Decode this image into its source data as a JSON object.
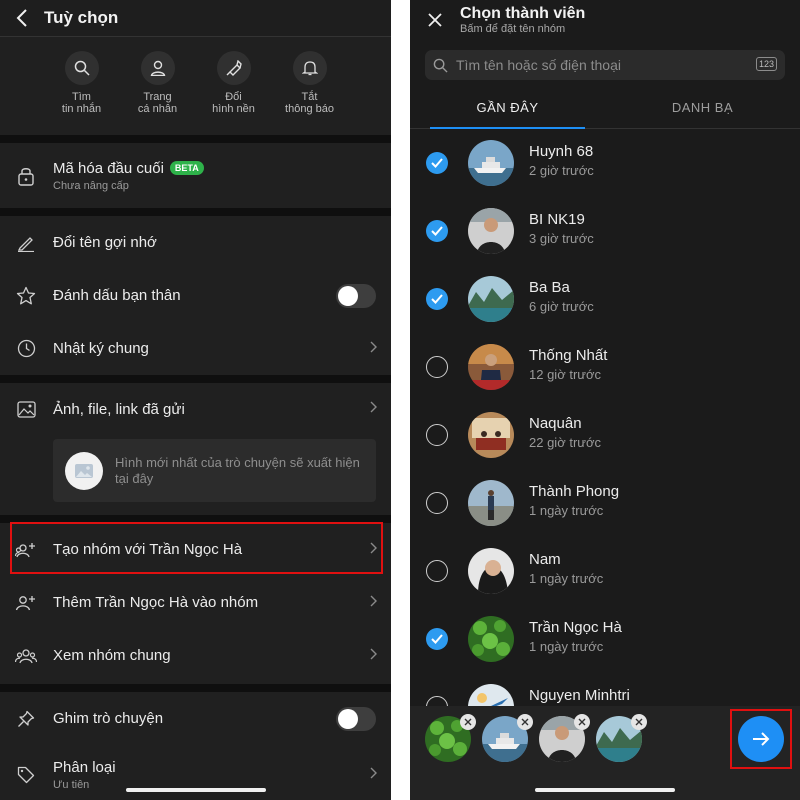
{
  "left": {
    "header": {
      "title": "Tuỳ chọn"
    },
    "quick_actions": [
      {
        "label": "Tìm\ntin nhắn",
        "icon": "search-icon"
      },
      {
        "label": "Trang\ncá nhân",
        "icon": "person-icon"
      },
      {
        "label": "Đổi\nhình nền",
        "icon": "brush-icon"
      },
      {
        "label": "Tắt\nthông báo",
        "icon": "bell-icon"
      }
    ],
    "encryption": {
      "title": "Mã hóa đầu cuối",
      "badge": "BETA",
      "subtitle": "Chưa nâng cấp"
    },
    "rename": {
      "label": "Đổi tên gợi nhớ"
    },
    "best_friend": {
      "label": "Đánh dấu bạn thân",
      "toggle": "off"
    },
    "shared_diary": {
      "label": "Nhật ký chung"
    },
    "media": {
      "label": "Ảnh, file, link đã gửi",
      "empty_text": "Hình mới nhất của trò chuyện sẽ xuất hiện tại đây"
    },
    "create_group": {
      "label": "Tạo nhóm với Trần Ngọc Hà"
    },
    "add_to_group": {
      "label": "Thêm Trần Ngọc Hà vào nhóm"
    },
    "common_groups": {
      "label": "Xem nhóm chung"
    },
    "pin_chat": {
      "label": "Ghim trò chuyện",
      "toggle": "off"
    },
    "category": {
      "label": "Phân loại",
      "subtitle": "Ưu tiên"
    }
  },
  "right": {
    "header": {
      "title": "Chọn thành viên",
      "subtitle": "Bấm để đặt tên nhóm"
    },
    "search": {
      "placeholder": "Tìm tên hoặc số điện thoại",
      "keyboard_badge": "123"
    },
    "tabs": [
      {
        "label": "GẦN ĐÂY",
        "active": true
      },
      {
        "label": "DANH BẠ",
        "active": false
      }
    ],
    "contacts": [
      {
        "name": "Huynh 68",
        "time": "2 giờ trước",
        "checked": true
      },
      {
        "name": "BI NK19",
        "time": "3 giờ trước",
        "checked": true
      },
      {
        "name": "Ba Ba",
        "time": "6 giờ trước",
        "checked": true
      },
      {
        "name": "Thống Nhất",
        "time": "12 giờ trước",
        "checked": false
      },
      {
        "name": "Naquân",
        "time": "22 giờ trước",
        "checked": false
      },
      {
        "name": "Thành Phong",
        "time": "1 ngày trước",
        "checked": false
      },
      {
        "name": "Nam",
        "time": "1 ngày trước",
        "checked": false
      },
      {
        "name": "Trần Ngọc Hà",
        "time": "1 ngày trước",
        "checked": true
      },
      {
        "name": "Nguyen Minhtri",
        "time": "",
        "checked": false
      }
    ],
    "selected_count": 4,
    "colors": {
      "accent": "#1e8ff5",
      "highlight": "#e01010"
    }
  }
}
